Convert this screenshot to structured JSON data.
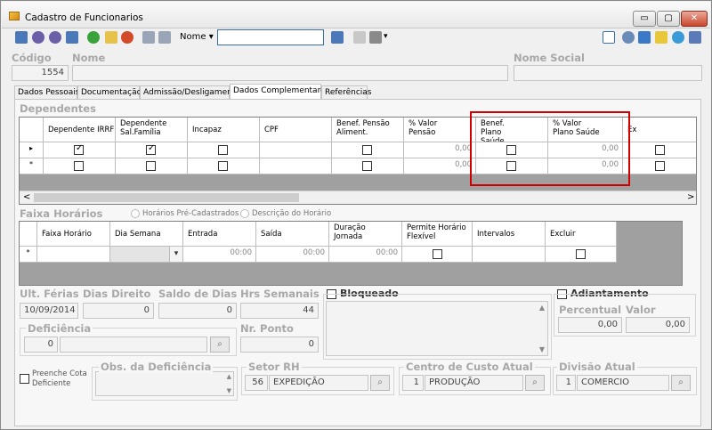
{
  "window": {
    "title": "Cadastro de Funcionarios",
    "min": "▭",
    "max": "▢",
    "close": "✕"
  },
  "toolbar": {
    "search_field_label": "Nome",
    "search_value": "",
    "dropdown_arrow": "▾"
  },
  "header": {
    "codigo_label": "Código",
    "codigo_value": "1554",
    "nome_label": "Nome",
    "nome_value": "",
    "nome_social_label": "Nome Social",
    "nome_social_value": ""
  },
  "tabs": [
    {
      "label": "Dados Pessoais"
    },
    {
      "label": "Documentação"
    },
    {
      "label": "Admissão/Desligamento"
    },
    {
      "label": "Dados Complementares"
    },
    {
      "label": "Referências"
    }
  ],
  "dependentes": {
    "section_label": "Dependentes",
    "columns": [
      "Dependente IRRF",
      "Dependente Sal.Família",
      "Incapaz",
      "CPF",
      "Benef. Pensão Aliment.",
      "% Valor Pensão",
      "Benef. Plano Saúde",
      "% Valor Plano Saúde",
      "Ex"
    ],
    "rows": [
      {
        "marker": "▸",
        "irrf": true,
        "salfam": true,
        "incapaz": false,
        "cpf": "",
        "pensao": false,
        "valor_pensao": "0,00",
        "plano": false,
        "valor_plano": "0,00",
        "ex": false
      },
      {
        "marker": "*",
        "irrf": false,
        "salfam": false,
        "incapaz": false,
        "cpf": "",
        "pensao": false,
        "valor_pensao": "0,00",
        "plano": false,
        "valor_plano": "0,00",
        "ex": false
      }
    ],
    "scroll_left": "<",
    "scroll_right": ">"
  },
  "faixa": {
    "section_label": "Faixa Horários",
    "radio1": "Horários Pré-Cadastrados",
    "radio2": "Descrição do Horário",
    "columns": [
      "Faixa Horário",
      "Dia Semana",
      "Entrada",
      "Saída",
      "Duração Jornada",
      "Permite Horário Flexível",
      "Intervalos",
      "Excluir"
    ],
    "row": {
      "marker": "*",
      "faixa": "",
      "dia": "",
      "entrada": "00:00",
      "saida": "00:00",
      "duracao": "00:00"
    }
  },
  "ferias": {
    "ult_ferias_label": "Ult. Férias",
    "ult_ferias_value": "10/09/2014",
    "dias_direito_label": "Dias Direito",
    "dias_direito_value": "0",
    "saldo_label": "Saldo de Dias",
    "saldo_value": "0",
    "hrs_label": "Hrs Semanais",
    "hrs_value": "44",
    "nr_ponto_label": "Nr. Ponto",
    "nr_ponto_value": "0"
  },
  "bloqueado": {
    "label": "Bloqueado"
  },
  "adiantamento": {
    "label": "Adiantamento",
    "percentual_label": "Percentual",
    "percentual_value": "0,00",
    "valor_label": "Valor",
    "valor_value": "0,00"
  },
  "deficiencia": {
    "label": "Deficiência",
    "code": "0",
    "desc": "",
    "preenche_label": "Preenche Cota Deficiente",
    "obs_label": "Obs. da Deficiência"
  },
  "setor": {
    "label": "Setor RH",
    "code": "56",
    "name": "EXPEDIÇÃO"
  },
  "centro": {
    "label": "Centro de Custo Atual",
    "code": "1",
    "name": "PRODUÇÃO"
  },
  "divisao": {
    "label": "Divisão Atual",
    "code": "1",
    "name": "COMERCIO"
  },
  "colors": {
    "accent": "#d00000",
    "title_bar": "#e8e8e8"
  }
}
